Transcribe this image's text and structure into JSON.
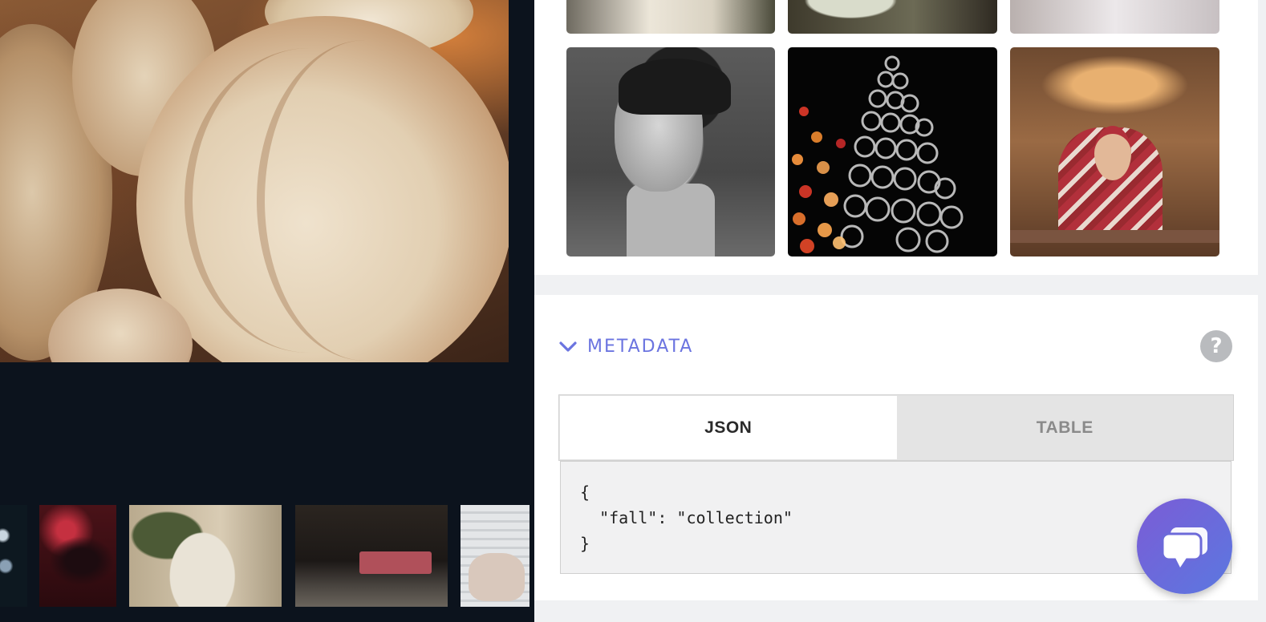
{
  "viewer": {
    "main_image": "pumpkins-photo",
    "filmstrip": [
      "lights-thumb",
      "sunglasses-thumb",
      "bouquet-thumb",
      "bedroom-thumb",
      "hand-thumb"
    ]
  },
  "gallery": {
    "top_row": [
      "dress-photo",
      "plant-photo",
      "fabric-photo"
    ],
    "row": [
      "bw-portrait-photo",
      "bokeh-lights-photo",
      "red-sweater-woman-photo"
    ]
  },
  "metadata": {
    "title": "METADATA",
    "help_label": "?",
    "tabs": {
      "json": "JSON",
      "table": "TABLE"
    },
    "active_tab": "JSON",
    "json_text": "{\n  \"fall\": \"collection\"\n}"
  },
  "colors": {
    "accent": "#6b74e0",
    "chat_gradient_start": "#7b5cd6",
    "chat_gradient_end": "#5b78e0",
    "viewer_bg": "#0c131d",
    "panel_bg": "#f0f1f3"
  }
}
